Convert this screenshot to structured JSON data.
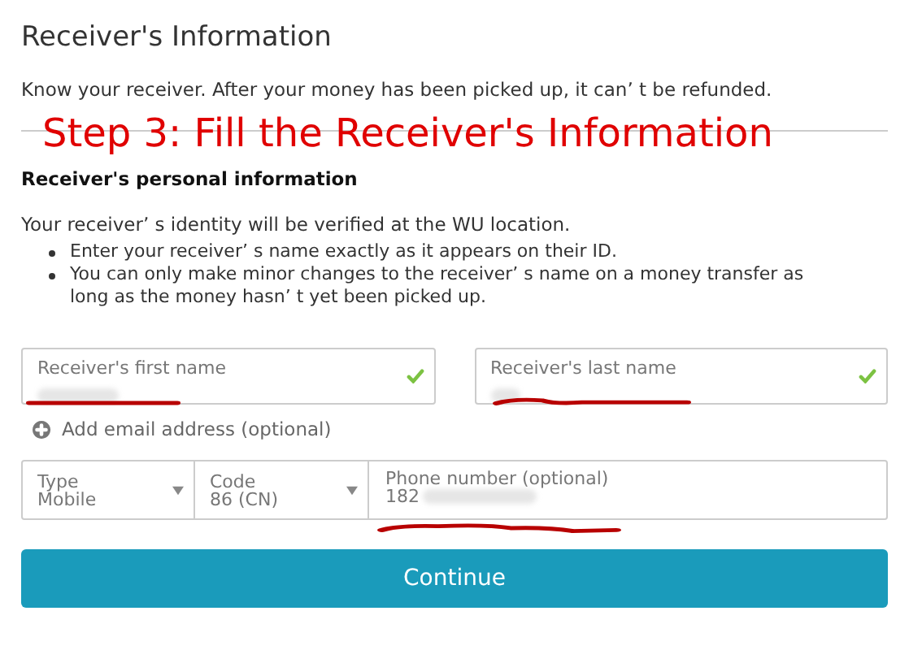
{
  "title": "Receiver's Information",
  "intro": "Know your receiver. After your money has been picked up, it can’ t be refunded.",
  "annotation": {
    "caption": "Step 3: Fill the Receiver's Information"
  },
  "section": {
    "heading": "Receiver's personal information",
    "note": "Your receiver’ s identity will be verified at the WU location.",
    "bullets": [
      "Enter your receiver’ s name exactly as it appears on their ID.",
      "You can only make minor changes to the receiver’ s name on a money transfer as long as the money hasn’ t yet been picked up."
    ]
  },
  "name_fields": [
    {
      "label": "Receiver's first name",
      "valid": true
    },
    {
      "label": "Receiver's last name",
      "valid": true
    }
  ],
  "add_email": {
    "label": "Add email address (optional)"
  },
  "phone": {
    "type": {
      "label": "Type",
      "value": "Mobile"
    },
    "code": {
      "label": "Code",
      "value": "86 (CN)"
    },
    "number": {
      "label": "Phone number (optional)",
      "value": "182"
    }
  },
  "button": {
    "label": "Continue"
  }
}
